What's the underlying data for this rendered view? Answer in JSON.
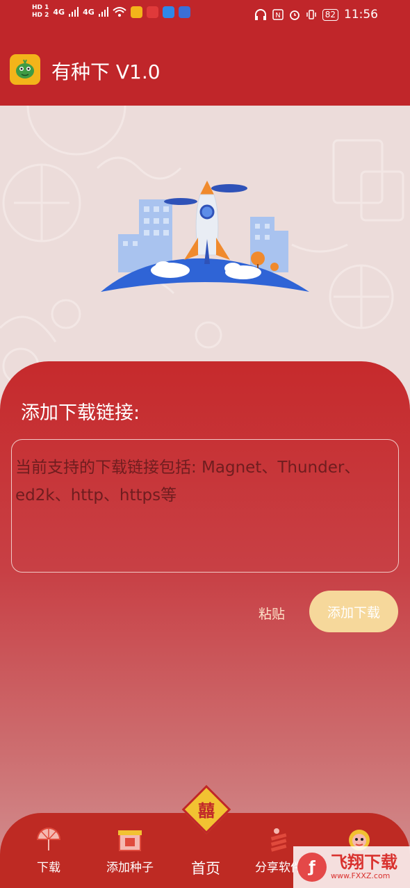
{
  "status_bar": {
    "hd1": "HD 1",
    "hd2": "HD 2",
    "sig1": "4G",
    "sig2": "4G",
    "battery": "82",
    "time": "11:56"
  },
  "app_bar": {
    "title": "有种下 V1.0"
  },
  "main": {
    "section_title": "添加下载链接:",
    "url_placeholder": "当前支持的下载链接包括: Magnet、Thunder、ed2k、http、https等",
    "paste_label": "粘贴",
    "add_download_label": "添加下载"
  },
  "bottom_nav": {
    "items": [
      {
        "label": "下载"
      },
      {
        "label": "添加种子"
      },
      {
        "label": "首页"
      },
      {
        "label": "分享软件"
      },
      {
        "label": ""
      }
    ],
    "home_glyph": "囍"
  },
  "watermark": {
    "brand": "飞翔下载",
    "url": "www.FXXZ.com"
  },
  "colors": {
    "primary_red": "#c0262a",
    "accent_gold": "#f6d89b",
    "app_icon_bg": "#f3b41a"
  }
}
